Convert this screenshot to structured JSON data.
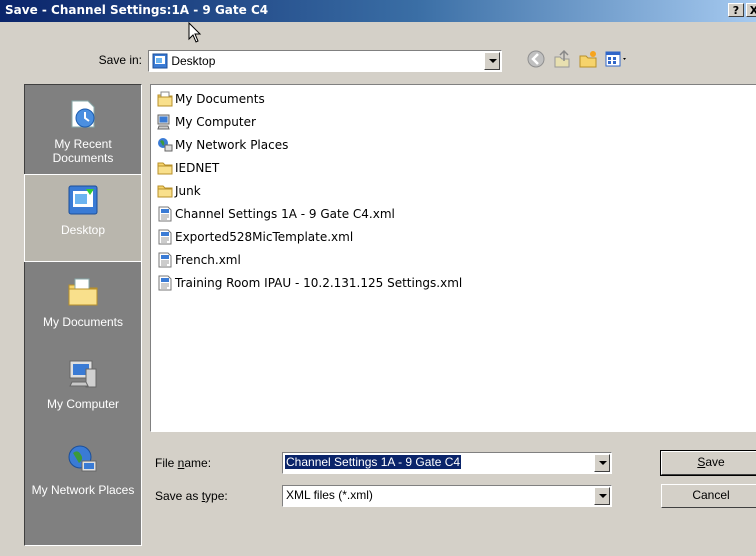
{
  "window": {
    "title": "Save - Channel Settings:1A - 9 Gate C4",
    "help_label": "?",
    "close_label": "X"
  },
  "savein": {
    "label": "Save in:",
    "value": "Desktop"
  },
  "places": [
    {
      "label": "My Recent Documents",
      "icon": "recent-documents-icon"
    },
    {
      "label": "Desktop",
      "icon": "desktop-icon",
      "selected": true
    },
    {
      "label": "My Documents",
      "icon": "my-documents-icon"
    },
    {
      "label": "My Computer",
      "icon": "my-computer-icon"
    },
    {
      "label": "My Network Places",
      "icon": "network-places-icon"
    }
  ],
  "files": [
    {
      "name": "My Documents",
      "icon": "my-documents-icon"
    },
    {
      "name": "My Computer",
      "icon": "my-computer-icon"
    },
    {
      "name": "My Network Places",
      "icon": "network-places-icon"
    },
    {
      "name": "IEDNET",
      "icon": "folder-icon"
    },
    {
      "name": "Junk",
      "icon": "folder-icon"
    },
    {
      "name": "Channel Settings 1A - 9 Gate C4.xml",
      "icon": "xml-file-icon"
    },
    {
      "name": "Exported528MicTemplate.xml",
      "icon": "xml-file-icon"
    },
    {
      "name": "French.xml",
      "icon": "xml-file-icon"
    },
    {
      "name": "Training Room IPAU - 10.2.131.125 Settings.xml",
      "icon": "xml-file-icon"
    }
  ],
  "filename": {
    "label_pre": "File ",
    "label_key": "n",
    "label_post": "ame:",
    "value": "Channel Settings 1A - 9 Gate C4"
  },
  "savetype": {
    "label_pre": "Save as ",
    "label_key": "t",
    "label_post": "ype:",
    "value": "XML files (*.xml)"
  },
  "buttons": {
    "save_key": "S",
    "save_rest": "ave",
    "cancel": "Cancel"
  }
}
